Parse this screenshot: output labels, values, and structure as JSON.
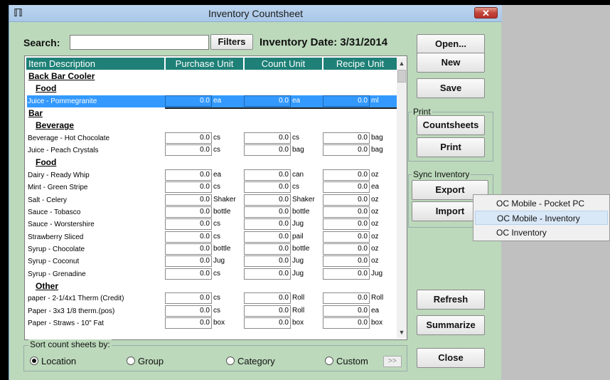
{
  "window": {
    "title": "Inventory Countsheet",
    "app_icon": "knife-fork-icon",
    "close_glyph": "✕"
  },
  "search": {
    "label": "Search:",
    "value": "",
    "filters_label": "Filters"
  },
  "inventory_date": "Inventory Date: 3/31/2014",
  "grid": {
    "columns": [
      "Item Description",
      "Purchase Unit",
      "Count Unit",
      "Recipe Unit"
    ],
    "rows": [
      {
        "type": "location",
        "label": "Back Bar Cooler"
      },
      {
        "type": "group",
        "label": "Food"
      },
      {
        "type": "item",
        "name": "Juice - Pommegranite",
        "purchase_qty": "0.0",
        "purchase_unit": "ea",
        "count_qty": "0.0",
        "count_unit": "ea",
        "recipe_qty": "0.0",
        "recipe_unit": "ml",
        "selected": true
      },
      {
        "type": "location",
        "label": "Bar"
      },
      {
        "type": "group",
        "label": "Beverage"
      },
      {
        "type": "item",
        "name": "Beverage - Hot Chocolate",
        "purchase_qty": "0.0",
        "purchase_unit": "cs",
        "count_qty": "0.0",
        "count_unit": "cs",
        "recipe_qty": "0.0",
        "recipe_unit": "bag"
      },
      {
        "type": "item",
        "name": "Juice - Peach Crystals",
        "purchase_qty": "0.0",
        "purchase_unit": "cs",
        "count_qty": "0.0",
        "count_unit": "bag",
        "recipe_qty": "0.0",
        "recipe_unit": "bag"
      },
      {
        "type": "group",
        "label": "Food"
      },
      {
        "type": "item",
        "name": "Dairy - Ready Whip",
        "purchase_qty": "0.0",
        "purchase_unit": "ea",
        "count_qty": "0.0",
        "count_unit": "can",
        "recipe_qty": "0.0",
        "recipe_unit": "oz"
      },
      {
        "type": "item",
        "name": "Mint - Green Stripe",
        "purchase_qty": "0.0",
        "purchase_unit": "cs",
        "count_qty": "0.0",
        "count_unit": "cs",
        "recipe_qty": "0.0",
        "recipe_unit": "ea"
      },
      {
        "type": "item",
        "name": "Salt - Celery",
        "purchase_qty": "0.0",
        "purchase_unit": "Shaker",
        "count_qty": "0.0",
        "count_unit": "Shaker",
        "recipe_qty": "0.0",
        "recipe_unit": "oz"
      },
      {
        "type": "item",
        "name": "Sauce - Tobasco",
        "purchase_qty": "0.0",
        "purchase_unit": "bottle",
        "count_qty": "0.0",
        "count_unit": "bottle",
        "recipe_qty": "0.0",
        "recipe_unit": "oz"
      },
      {
        "type": "item",
        "name": "Sauce - Worstershire",
        "purchase_qty": "0.0",
        "purchase_unit": "cs",
        "count_qty": "0.0",
        "count_unit": "Jug",
        "recipe_qty": "0.0",
        "recipe_unit": "oz"
      },
      {
        "type": "item",
        "name": "Strawberry Sliced",
        "purchase_qty": "0.0",
        "purchase_unit": "cs",
        "count_qty": "0.0",
        "count_unit": "pail",
        "recipe_qty": "0.0",
        "recipe_unit": "oz"
      },
      {
        "type": "item",
        "name": "Syrup - Chocolate",
        "purchase_qty": "0.0",
        "purchase_unit": "bottle",
        "count_qty": "0.0",
        "count_unit": "bottle",
        "recipe_qty": "0.0",
        "recipe_unit": "oz"
      },
      {
        "type": "item",
        "name": "Syrup - Coconut",
        "purchase_qty": "0.0",
        "purchase_unit": "Jug",
        "count_qty": "0.0",
        "count_unit": "Jug",
        "recipe_qty": "0.0",
        "recipe_unit": "oz"
      },
      {
        "type": "item",
        "name": "Syrup - Grenadine",
        "purchase_qty": "0.0",
        "purchase_unit": "cs",
        "count_qty": "0.0",
        "count_unit": "Jug",
        "recipe_qty": "0.0",
        "recipe_unit": "Jug"
      },
      {
        "type": "group",
        "label": "Other"
      },
      {
        "type": "item",
        "name": "paper - 2-1/4x1 Therm (Credit)",
        "purchase_qty": "0.0",
        "purchase_unit": "cs",
        "count_qty": "0.0",
        "count_unit": "Roll",
        "recipe_qty": "0.0",
        "recipe_unit": "Roll"
      },
      {
        "type": "item",
        "name": "Paper - 3x3 1/8 therm.(pos)",
        "purchase_qty": "0.0",
        "purchase_unit": "cs",
        "count_qty": "0.0",
        "count_unit": "Roll",
        "recipe_qty": "0.0",
        "recipe_unit": "ea"
      },
      {
        "type": "item",
        "name": "Paper - Straws - 10\" Fat",
        "purchase_qty": "0.0",
        "purchase_unit": "box",
        "count_qty": "0.0",
        "count_unit": "box",
        "recipe_qty": "0.0",
        "recipe_unit": "box"
      }
    ]
  },
  "sort": {
    "legend": "Sort count sheets by:",
    "options": [
      "Location",
      "Group",
      "Category",
      "Custom"
    ],
    "selected": "Location",
    "custom_button": ">>"
  },
  "buttons": {
    "open": "Open...",
    "new": "New",
    "save": "Save",
    "countsheets": "Countsheets",
    "print": "Print",
    "export": "Export",
    "import": "Import",
    "refresh": "Refresh",
    "summarize": "Summarize",
    "close": "Close"
  },
  "groups": {
    "print": "Print",
    "sync": "Sync Inventory"
  },
  "export_menu": {
    "items": [
      "OC Mobile - Pocket PC",
      "OC Mobile - Inventory",
      "OC Inventory"
    ],
    "highlighted": "OC Mobile - Inventory"
  },
  "colors": {
    "window_bg": "#bcd9bb",
    "header_bg": "#1e8077",
    "selection": "#3399ff"
  }
}
